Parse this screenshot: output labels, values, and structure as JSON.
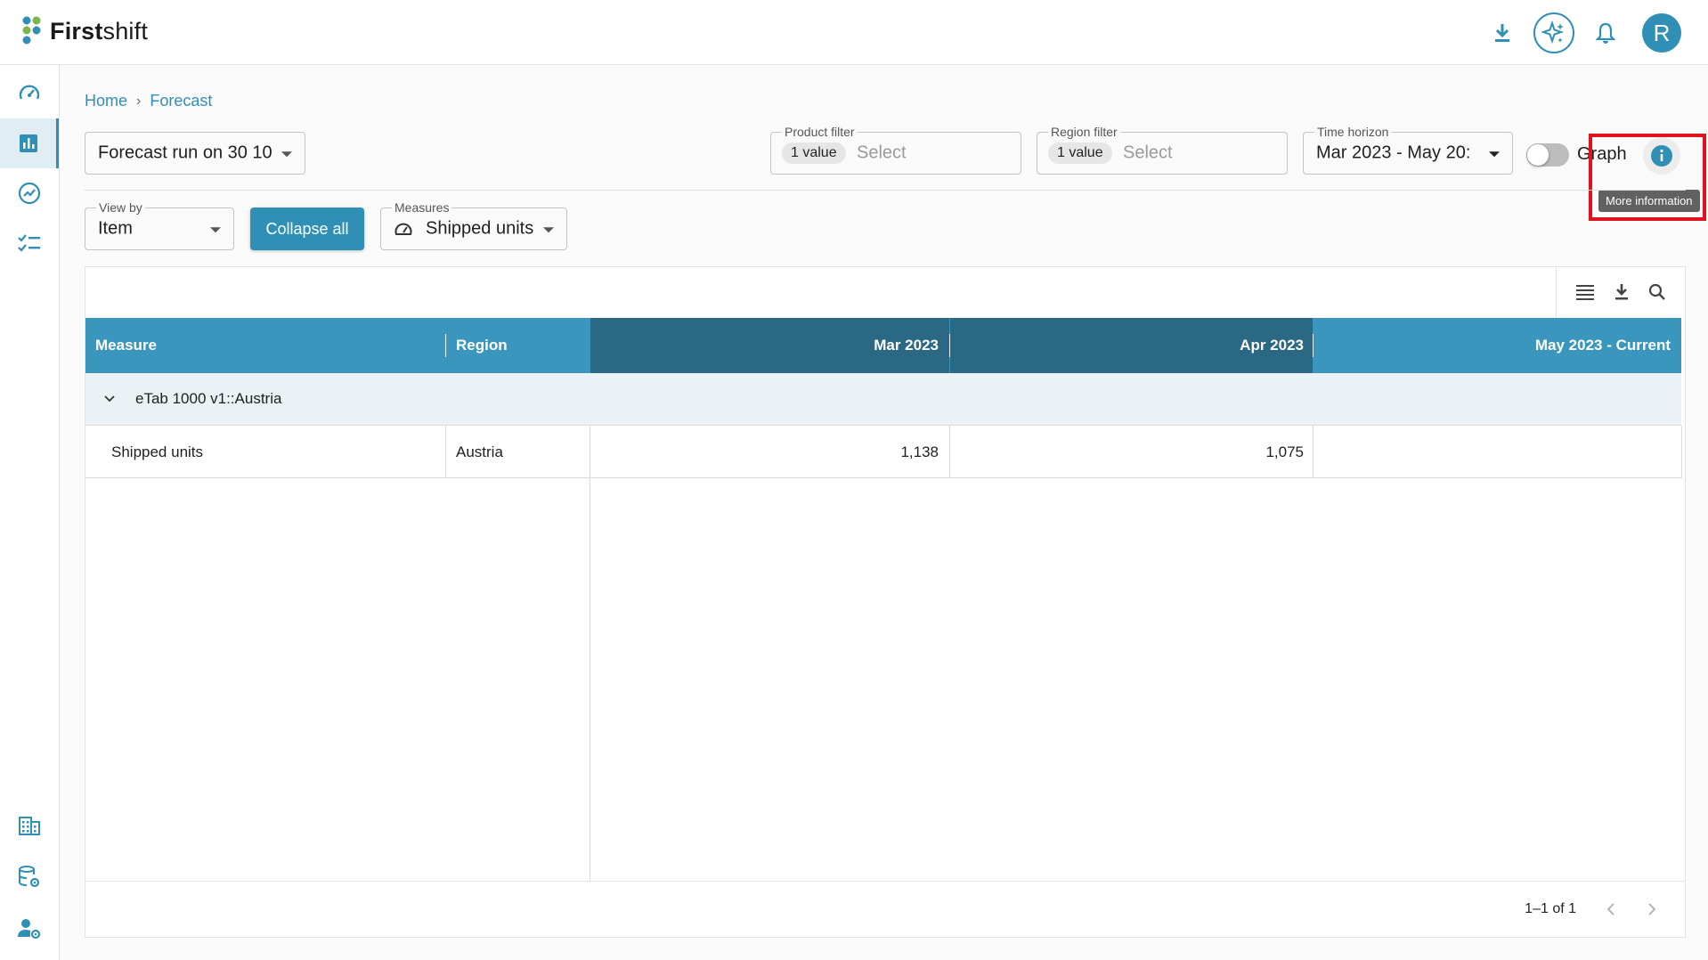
{
  "app": {
    "logo_text_bold": "First",
    "logo_text_rest": "shift",
    "avatar_initial": "R",
    "accent_color": "#2f8fb5"
  },
  "top_actions": {
    "icons": [
      "download-icon",
      "ai-sparkle-icon",
      "bell-icon"
    ]
  },
  "sidebar": {
    "top_items": [
      "dashboard-icon",
      "bar-chart-icon",
      "trend-icon",
      "checklist-icon"
    ],
    "bottom_items": [
      "building-icon",
      "database-settings-icon",
      "user-settings-icon"
    ],
    "active_index": 1
  },
  "breadcrumb": {
    "home": "Home",
    "separator": "›",
    "current": "Forecast"
  },
  "filters": {
    "forecast_run": "Forecast run on 30 10",
    "product_filter": {
      "label": "Product filter",
      "chip": "1 value",
      "placeholder": "Select"
    },
    "region_filter": {
      "label": "Region filter",
      "chip": "1 value",
      "placeholder": "Select"
    },
    "time_horizon": {
      "label": "Time horizon",
      "value": "Mar 2023 - May 20:"
    },
    "graph_label": "Graph",
    "graph_toggle_on": false,
    "tooltip": "More information"
  },
  "controls": {
    "view_by": {
      "label": "View by",
      "value": "Item"
    },
    "collapse_button": "Collapse all",
    "measures": {
      "label": "Measures",
      "value": "Shipped units"
    }
  },
  "grid": {
    "toolbar_icons": [
      "columns-menu-icon",
      "download-icon",
      "search-icon"
    ],
    "headers": {
      "measure": "Measure",
      "region": "Region",
      "col1": "Mar 2023",
      "col2": "Apr 2023",
      "col3": "May 2023 - Current"
    },
    "group_row": "eTab 1000 v1::Austria",
    "rows": [
      {
        "measure": "Shipped units",
        "region": "Austria",
        "mar": "1,138",
        "apr": "1,075",
        "may": ""
      }
    ],
    "pagination": "1–1 of 1"
  }
}
